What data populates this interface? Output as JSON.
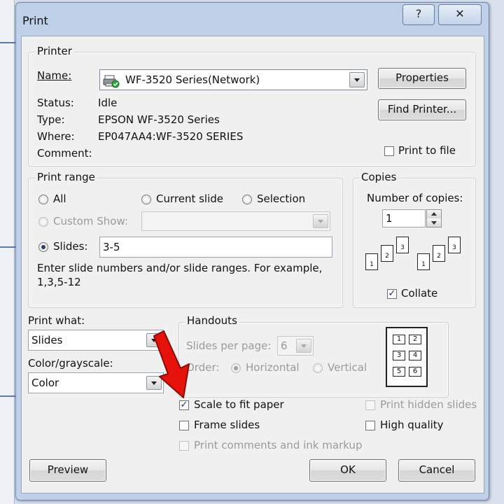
{
  "window": {
    "title": "Print",
    "help_label": "?",
    "close_label": "✕"
  },
  "printer": {
    "group_label": "Printer",
    "name_label": "Name:",
    "name_value": "WF-3520 Series(Network)",
    "status_label": "Status:",
    "status_value": "Idle",
    "type_label": "Type:",
    "type_value": "EPSON WF-3520 Series",
    "where_label": "Where:",
    "where_value": "EP047AA4:WF-3520 SERIES",
    "comment_label": "Comment:",
    "comment_value": "",
    "properties_label": "Properties",
    "find_printer_label": "Find Printer...",
    "print_to_file_label": "Print to file"
  },
  "print_range": {
    "group_label": "Print range",
    "all_label": "All",
    "current_slide_label": "Current slide",
    "selection_label": "Selection",
    "custom_show_label": "Custom Show:",
    "custom_show_value": "",
    "slides_label": "Slides:",
    "slides_value": "3-5",
    "help_line1": "Enter slide numbers and/or slide ranges. For example,",
    "help_line2": "1,3,5-12"
  },
  "copies": {
    "group_label": "Copies",
    "number_label": "Number of copies:",
    "number_value": "1",
    "collate_label": "Collate",
    "collate_checked": true,
    "page_numbers": [
      "1",
      "2",
      "3"
    ]
  },
  "print_what": {
    "label": "Print what:",
    "value": "Slides",
    "color_label": "Color/grayscale:",
    "color_value": "Color"
  },
  "handouts": {
    "group_label": "Handouts",
    "slides_per_page_label": "Slides per page:",
    "slides_per_page_value": "6",
    "order_label": "Order:",
    "horizontal_label": "Horizontal",
    "vertical_label": "Vertical",
    "preview_numbers": [
      "1",
      "2",
      "3",
      "4",
      "5",
      "6"
    ]
  },
  "options": {
    "scale_label": "Scale to fit paper",
    "scale_checked": true,
    "frame_label": "Frame slides",
    "comments_label": "Print comments and ink markup",
    "hidden_label": "Print hidden slides",
    "quality_label": "High quality"
  },
  "footer": {
    "preview_label": "Preview",
    "ok_label": "OK",
    "cancel_label": "Cancel"
  },
  "colors": {
    "annotation_arrow": "#e8120c",
    "title_bar": "#bfd1e8"
  }
}
